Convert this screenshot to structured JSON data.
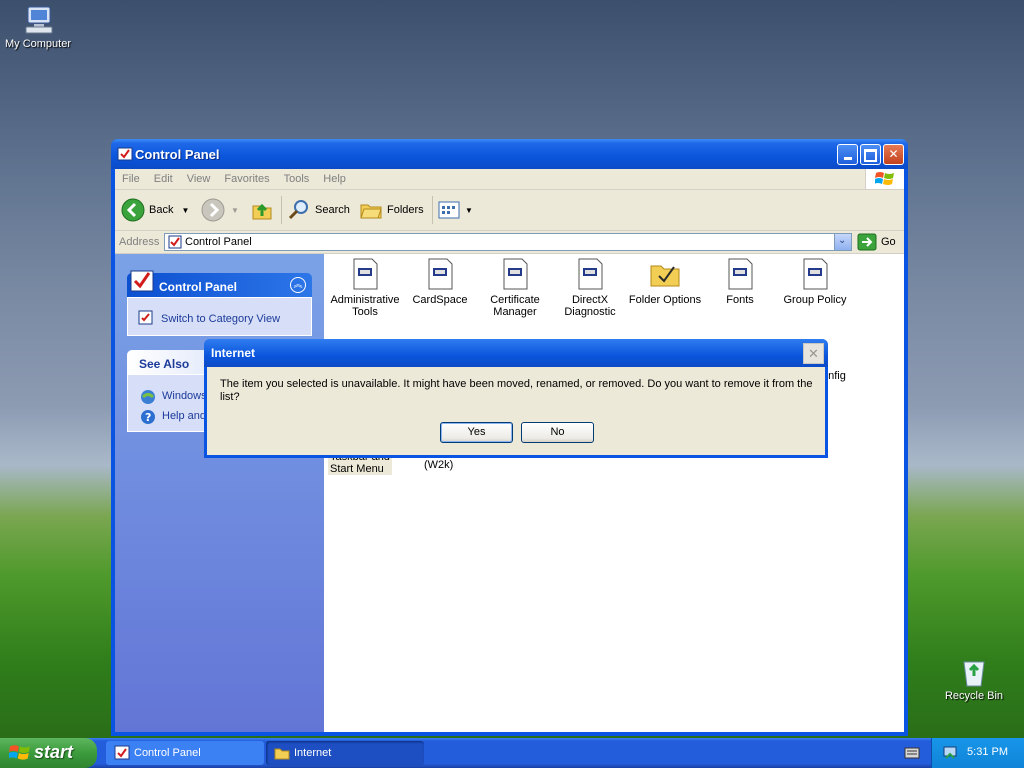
{
  "desktop": {
    "icons": [
      "My Computer",
      "Recycle Bin"
    ]
  },
  "window": {
    "title": "Control Panel",
    "menu": [
      "File",
      "Edit",
      "View",
      "Favorites",
      "Tools",
      "Help"
    ],
    "toolbar": {
      "back": "Back",
      "search": "Search",
      "folders": "Folders"
    },
    "address": {
      "label": "Address",
      "value": "Control Panel",
      "go": "Go"
    },
    "sidebar": {
      "panel_title": "Control Panel",
      "switch_view": "Switch to Category View",
      "see_also": "See Also",
      "see_also_items": [
        "Windows",
        "Help and"
      ]
    },
    "items": [
      {
        "label": "Administrative Tools"
      },
      {
        "label": "CardSpace"
      },
      {
        "label": "Certificate Manager"
      },
      {
        "label": "DirectX Diagnostic"
      },
      {
        "label": "Folder Options"
      },
      {
        "label": "Fonts"
      },
      {
        "label": "Group Policy"
      }
    ],
    "partial_items": [
      "onfig",
      "Taskbar and Start Menu",
      "(W2k)"
    ]
  },
  "dialog": {
    "title": "Internet",
    "message": "The item you selected is unavailable.  It might have been moved, renamed, or removed.  Do you want to remove it from the list?",
    "yes": "Yes",
    "no": "No"
  },
  "taskbar": {
    "start": "start",
    "tasks": [
      "Control Panel",
      "Internet"
    ],
    "clock": "5:31 PM"
  }
}
